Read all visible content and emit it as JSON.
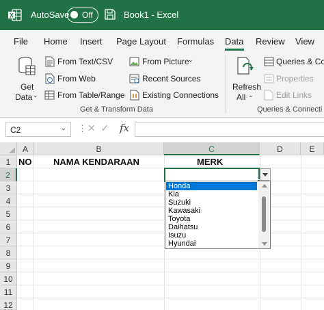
{
  "titlebar": {
    "autosave_label": "AutoSave",
    "autosave_state": "Off",
    "window_title": "Book1  -  Excel",
    "background_color": "#217346",
    "logo_icon": "excel-logo-icon",
    "save_icon": "save-icon"
  },
  "tabs": [
    {
      "label": "File"
    },
    {
      "label": "Home"
    },
    {
      "label": "Insert"
    },
    {
      "label": "Page Layout"
    },
    {
      "label": "Formulas"
    },
    {
      "label": "Data",
      "active": true
    },
    {
      "label": "Review"
    },
    {
      "label": "View"
    }
  ],
  "ribbon": {
    "get_data": {
      "line1": "Get",
      "line2": "Data",
      "icon": "database-icon"
    },
    "from_text_csv": {
      "label": "From Text/CSV",
      "icon": "text-file-icon"
    },
    "from_web": {
      "label": "From Web",
      "icon": "web-page-icon"
    },
    "from_table_range": {
      "label": "From Table/Range",
      "icon": "table-icon"
    },
    "from_picture": {
      "label": "From Picture",
      "icon": "picture-icon"
    },
    "recent_sources": {
      "label": "Recent Sources",
      "icon": "recent-sources-icon"
    },
    "existing_connections": {
      "label": "Existing Connections",
      "icon": "connections-icon"
    },
    "group1_label": "Get & Transform Data",
    "refresh_all": {
      "line1": "Refresh",
      "line2": "All",
      "icon": "refresh-icon"
    },
    "queries_connections": {
      "label": "Queries & Co",
      "icon": "queries-icon"
    },
    "properties": {
      "label": "Properties",
      "icon": "properties-icon"
    },
    "edit_links": {
      "label": "Edit Links",
      "icon": "edit-links-icon"
    },
    "group2_label": "Queries & Connecti"
  },
  "formula_bar": {
    "name_box": "C2",
    "formula_value": ""
  },
  "grid": {
    "columns": [
      "A",
      "B",
      "C",
      "D",
      "E"
    ],
    "selected_column": "C",
    "rows": [
      "1",
      "2",
      "3",
      "4",
      "5",
      "6",
      "7",
      "8",
      "9",
      "10",
      "11",
      "12"
    ],
    "selected_row": "2",
    "cells": {
      "A1": "NO",
      "B1": "NAMA KENDARAAN",
      "C1": "MERK"
    },
    "active_cell": "C2"
  },
  "dropdown": {
    "options": [
      "Honda",
      "Kia",
      "Suzuki",
      "Kawasaki",
      "Toyota",
      "Daihatsu",
      "Isuzu",
      "Hyundai"
    ],
    "selected": "Honda",
    "highlight_color": "#0078d7"
  }
}
